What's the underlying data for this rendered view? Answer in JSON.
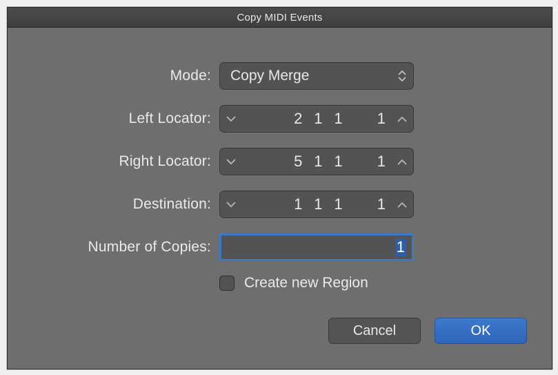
{
  "window": {
    "title": "Copy MIDI Events"
  },
  "labels": {
    "mode": "Mode:",
    "left_locator": "Left Locator:",
    "right_locator": "Right Locator:",
    "destination": "Destination:",
    "number_of_copies": "Number of Copies:",
    "create_new_region": "Create new Region"
  },
  "fields": {
    "mode_value": "Copy Merge",
    "left_locator": {
      "bar": "2",
      "beat": "1",
      "division": "1",
      "tick": "1"
    },
    "right_locator": {
      "bar": "5",
      "beat": "1",
      "division": "1",
      "tick": "1"
    },
    "destination": {
      "bar": "1",
      "beat": "1",
      "division": "1",
      "tick": "1"
    },
    "number_of_copies": "1",
    "create_new_region_checked": false
  },
  "buttons": {
    "cancel": "Cancel",
    "ok": "OK"
  }
}
